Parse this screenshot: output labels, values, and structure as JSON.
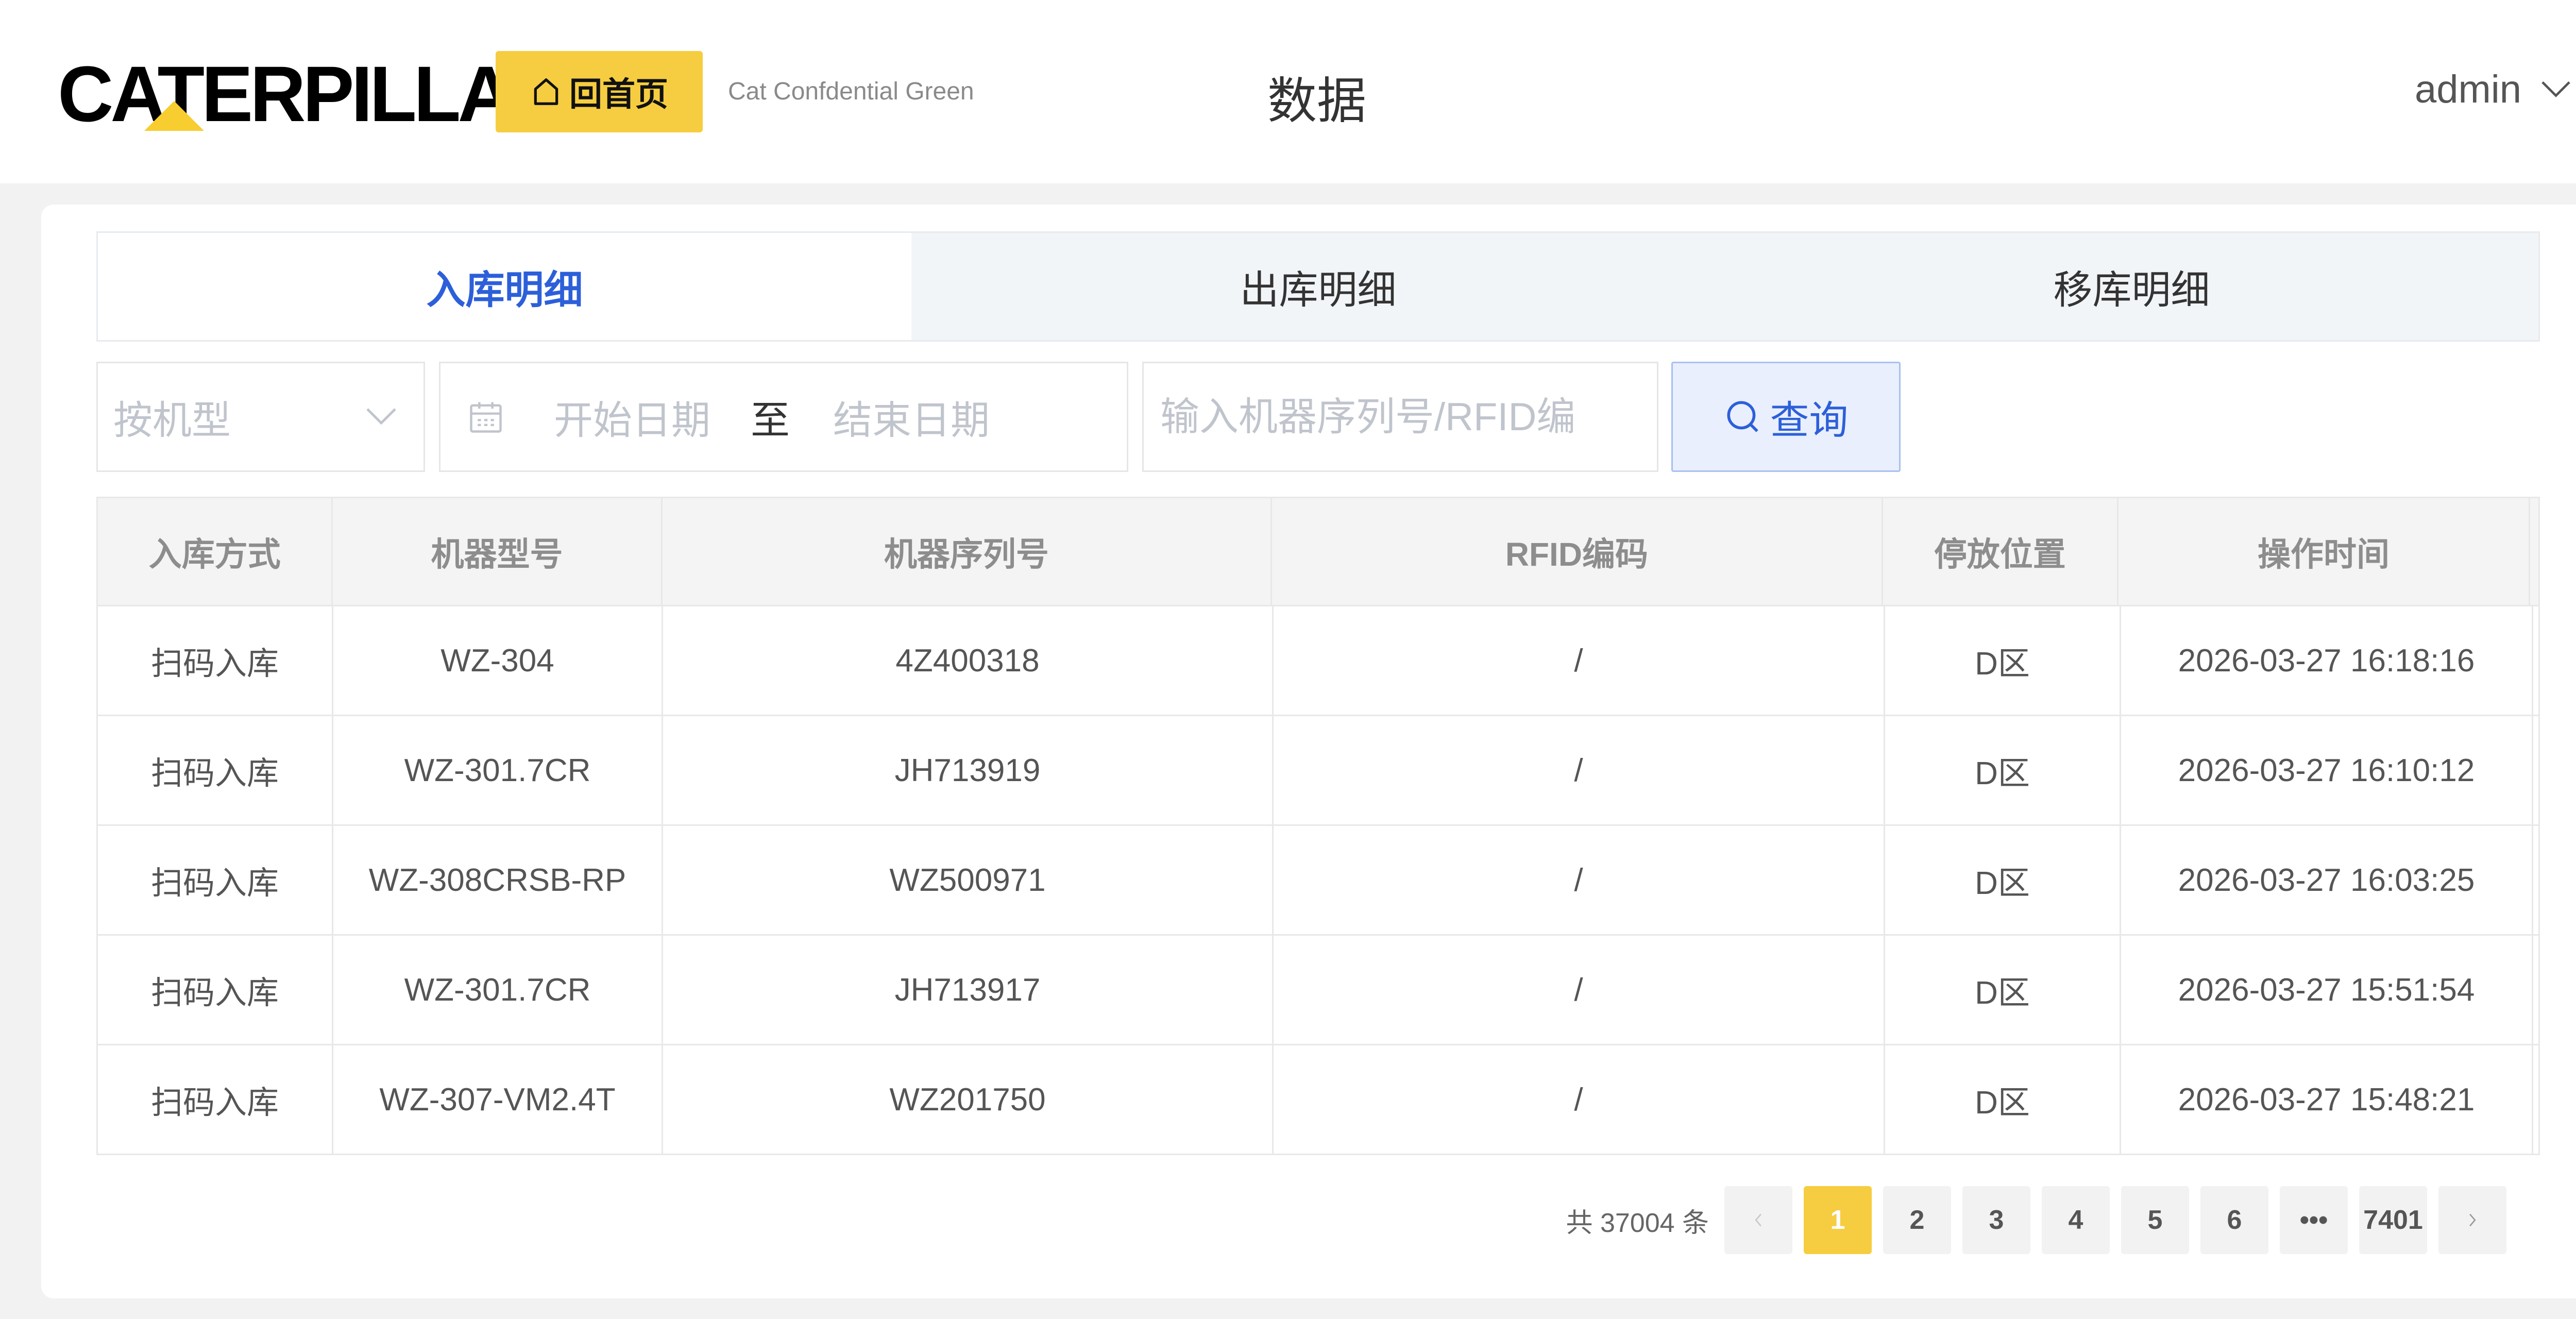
{
  "header": {
    "logo_text": "CATERPILLAR",
    "logo_mark": "®",
    "home_label": "回首页",
    "confidential": "Cat Confdential Green",
    "title": "数据",
    "user": "admin"
  },
  "tabs": [
    {
      "label": "入库明细",
      "active": true
    },
    {
      "label": "出库明细",
      "active": false
    },
    {
      "label": "移库明细",
      "active": false
    }
  ],
  "filters": {
    "model_placeholder": "按机型",
    "start_placeholder": "开始日期",
    "date_sep": "至",
    "end_placeholder": "结束日期",
    "serial_placeholder": "输入机器序列号/RFID编",
    "query_label": "查询"
  },
  "table": {
    "columns": [
      "入库方式",
      "机器型号",
      "机器序列号",
      "RFID编码",
      "停放位置",
      "操作时间"
    ],
    "rows": [
      [
        "扫码入库",
        "WZ-304",
        "4Z400318",
        "/",
        "D区",
        "2026-03-27 16:18:16"
      ],
      [
        "扫码入库",
        "WZ-301.7CR",
        "JH713919",
        "/",
        "D区",
        "2026-03-27 16:10:12"
      ],
      [
        "扫码入库",
        "WZ-308CRSB-RP",
        "WZ500971",
        "/",
        "D区",
        "2026-03-27 16:03:25"
      ],
      [
        "扫码入库",
        "WZ-301.7CR",
        "JH713917",
        "/",
        "D区",
        "2026-03-27 15:51:54"
      ],
      [
        "扫码入库",
        "WZ-307-VM2.4T",
        "WZ201750",
        "/",
        "D区",
        "2026-03-27 15:48:21"
      ]
    ]
  },
  "pagination": {
    "total_text": "共 37004 条",
    "pages": [
      "1",
      "2",
      "3",
      "4",
      "5",
      "6",
      "•••",
      "7401"
    ],
    "current": "1"
  },
  "colors": {
    "brand_yellow": "#f6cd40",
    "accent_blue": "#2c5fd9"
  }
}
